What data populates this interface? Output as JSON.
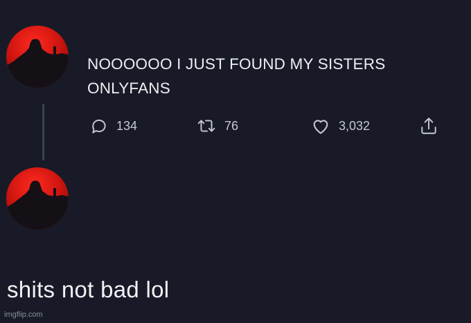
{
  "tweet": {
    "text_line1": "NOOOOOO I JUST FOUND MY SISTERS",
    "text_line2": "ONLYFANS",
    "reply_count": "134",
    "retweet_count": "76",
    "like_count": "3,032"
  },
  "reply": {
    "text": "shits not bad lol"
  },
  "watermark": "imgflip.com",
  "icons": {
    "reply": "speech-bubble-icon",
    "retweet": "retweet-icon",
    "like": "heart-icon",
    "share": "share-icon"
  },
  "colors": {
    "background": "#181b27",
    "avatar_red": "#d01510",
    "text": "#eceef2",
    "muted": "#c5c8d2"
  }
}
